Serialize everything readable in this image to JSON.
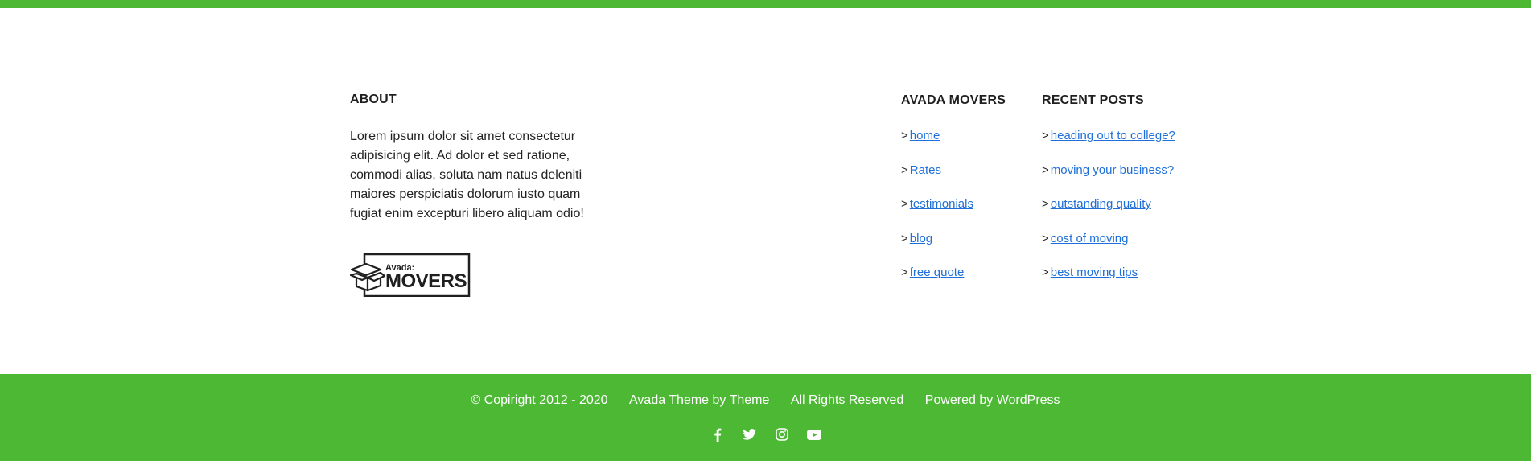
{
  "about": {
    "title": "ABOUT",
    "text": "Lorem ipsum dolor sit amet consectetur adipisicing elit. Ad dolor et sed ratione, commodi alias, soluta nam natus deleniti maiores perspiciatis dolorum iusto quam fugiat enim excepturi libero aliquam odio!",
    "logo_small": "Avada:",
    "logo_big": "MOVERS"
  },
  "movers": {
    "title": "AVADA MOVERS",
    "arrow": ">",
    "links": [
      "home",
      "Rates",
      "testimonials",
      "blog",
      "free quote"
    ]
  },
  "posts": {
    "title": "RECENT POSTS",
    "arrow": ">",
    "links": [
      "heading out to college?",
      "moving your business?",
      "outstanding quality",
      "cost of moving",
      "best moving tips"
    ]
  },
  "copyright": {
    "items": [
      "© Copiright 2012 - 2020",
      "Avada Theme by Theme",
      "All Rights Reserved",
      "Powered by WordPress"
    ]
  },
  "social": {
    "icons": [
      "facebook-icon",
      "twitter-icon",
      "instagram-icon",
      "youtube-icon"
    ]
  },
  "colors": {
    "brand_green": "#4cb833",
    "link_blue": "#1e6fd9"
  }
}
